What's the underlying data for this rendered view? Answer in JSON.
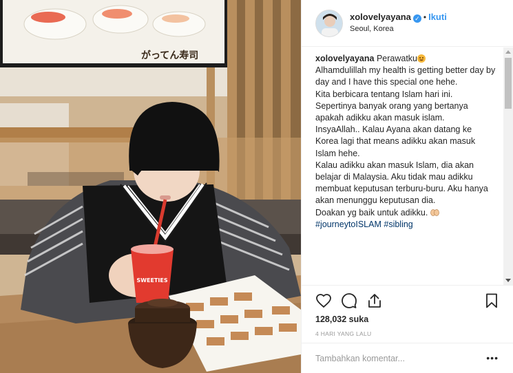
{
  "photo": {
    "sign_text": "がってん寿司",
    "cup_text": "SWEETIES"
  },
  "post": {
    "username": "xolovelyayana",
    "follow_label": "Ikuti",
    "location": "Seoul, Korea",
    "caption": {
      "username": "xolovelyayana",
      "first_text": "Perawatku",
      "paragraphs": [
        "Alhamdulillah my health is getting better day by day and I have this special one hehe.",
        "Kita berbicara tentang Islam hari ini. Sepertinya banyak orang yang bertanya apakah adikku akan masuk islam.",
        "InsyaAllah.. Kalau Ayana akan datang ke Korea lagi that means adikku akan masuk Islam hehe.",
        "Kalau adikku akan masuk Islam, dia akan belajar di Malaysia. Aku tidak mau adikku membuat keputusan terburu-buru. Aku hanya akan menunggu keputusan dia."
      ],
      "last_line": "Doakan yg baik untuk adikku.",
      "tags": [
        "#journeytoISLAM",
        "#sibling"
      ]
    },
    "likes_count": "128,032",
    "likes_label": "suka",
    "timestamp": "4 HARI YANG LALU",
    "comment_placeholder": "Tambahkan komentar...",
    "more_label": "•••",
    "icons": [
      "heart-icon",
      "comment-icon",
      "share-icon",
      "bookmark-icon"
    ]
  }
}
